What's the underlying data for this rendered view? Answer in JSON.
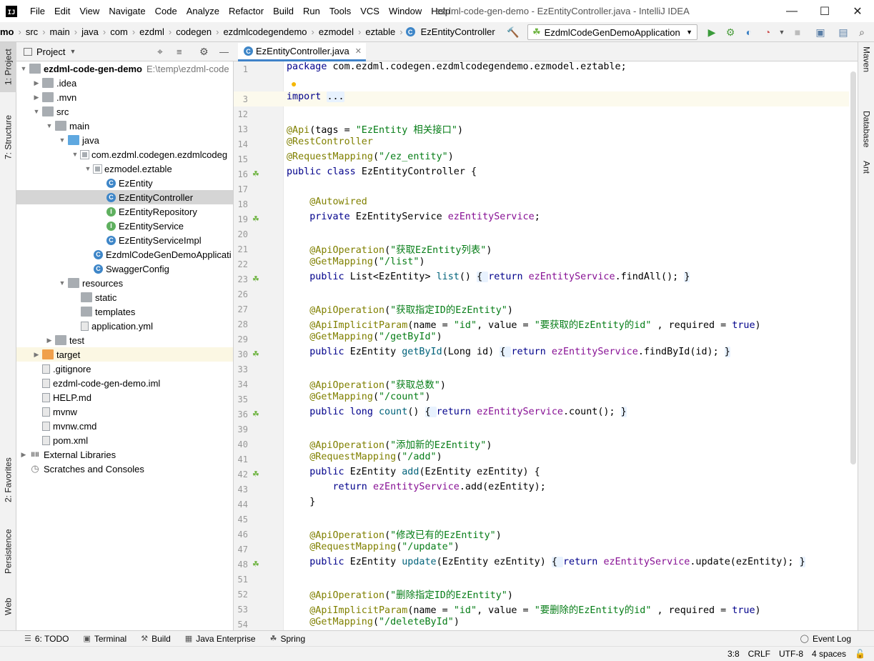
{
  "window": {
    "title": "ezdml-code-gen-demo - EzEntityController.java - IntelliJ IDEA",
    "app_icon": "IJ",
    "controls": [
      "—",
      "☐",
      "✕"
    ]
  },
  "menu": [
    "File",
    "Edit",
    "View",
    "Navigate",
    "Code",
    "Analyze",
    "Refactor",
    "Build",
    "Run",
    "Tools",
    "VCS",
    "Window",
    "Help"
  ],
  "breadcrumbs": [
    "mo",
    "src",
    "main",
    "java",
    "com",
    "ezdml",
    "codegen",
    "ezdmlcodegendemo",
    "ezmodel",
    "eztable",
    "EzEntityController"
  ],
  "run_config": "EzdmlCodeGenDemoApplication",
  "left_tools": [
    "1: Project",
    "7: Structure",
    "2: Favorites",
    "Persistence",
    "Web"
  ],
  "right_tools": [
    "Maven",
    "Database",
    "Ant"
  ],
  "project_panel": {
    "title": "Project",
    "tree": [
      {
        "label": "ezdml-code-gen-demo",
        "extra": "E:\\temp\\ezdml-code",
        "depth": 0,
        "arrow": "down",
        "icon": "folder",
        "bold": true
      },
      {
        "label": ".idea",
        "depth": 1,
        "arrow": "right",
        "icon": "folder"
      },
      {
        "label": ".mvn",
        "depth": 1,
        "arrow": "right",
        "icon": "folder"
      },
      {
        "label": "src",
        "depth": 1,
        "arrow": "down",
        "icon": "folder"
      },
      {
        "label": "main",
        "depth": 2,
        "arrow": "down",
        "icon": "folder"
      },
      {
        "label": "java",
        "depth": 3,
        "arrow": "down",
        "icon": "folder-blue"
      },
      {
        "label": "com.ezdml.codegen.ezdmlcodeg",
        "depth": 4,
        "arrow": "down",
        "icon": "package"
      },
      {
        "label": "ezmodel.eztable",
        "depth": 5,
        "arrow": "down",
        "icon": "package"
      },
      {
        "label": "EzEntity",
        "depth": 6,
        "arrow": "",
        "icon": "class"
      },
      {
        "label": "EzEntityController",
        "depth": 6,
        "arrow": "",
        "icon": "class",
        "selected": true
      },
      {
        "label": "EzEntityRepository",
        "depth": 6,
        "arrow": "",
        "icon": "interface"
      },
      {
        "label": "EzEntityService",
        "depth": 6,
        "arrow": "",
        "icon": "interface"
      },
      {
        "label": "EzEntityServiceImpl",
        "depth": 6,
        "arrow": "",
        "icon": "class"
      },
      {
        "label": "EzdmlCodeGenDemoApplicati",
        "depth": 5,
        "arrow": "",
        "icon": "class"
      },
      {
        "label": "SwaggerConfig",
        "depth": 5,
        "arrow": "",
        "icon": "class"
      },
      {
        "label": "resources",
        "depth": 3,
        "arrow": "down",
        "icon": "folder"
      },
      {
        "label": "static",
        "depth": 4,
        "arrow": "",
        "icon": "folder"
      },
      {
        "label": "templates",
        "depth": 4,
        "arrow": "",
        "icon": "folder"
      },
      {
        "label": "application.yml",
        "depth": 4,
        "arrow": "",
        "icon": "file"
      },
      {
        "label": "test",
        "depth": 2,
        "arrow": "right",
        "icon": "folder"
      },
      {
        "label": "target",
        "depth": 1,
        "arrow": "right",
        "icon": "folder-orange",
        "target": true
      },
      {
        "label": ".gitignore",
        "depth": 1,
        "arrow": "",
        "icon": "file"
      },
      {
        "label": "ezdml-code-gen-demo.iml",
        "depth": 1,
        "arrow": "",
        "icon": "file"
      },
      {
        "label": "HELP.md",
        "depth": 1,
        "arrow": "",
        "icon": "file"
      },
      {
        "label": "mvnw",
        "depth": 1,
        "arrow": "",
        "icon": "file"
      },
      {
        "label": "mvnw.cmd",
        "depth": 1,
        "arrow": "",
        "icon": "file"
      },
      {
        "label": "pom.xml",
        "depth": 1,
        "arrow": "",
        "icon": "file"
      },
      {
        "label": "External Libraries",
        "depth": 0,
        "arrow": "right",
        "icon": "library"
      },
      {
        "label": "Scratches and Consoles",
        "depth": 0,
        "arrow": "",
        "icon": "scratch"
      }
    ]
  },
  "editor": {
    "tab": "EzEntityController.java",
    "lines": [
      {
        "n": "1",
        "code": [
          [
            "kw",
            "package "
          ],
          [
            "",
            "com.ezdml.codegen.ezdmlcodegendemo.ezmodel.eztable;"
          ]
        ]
      },
      {
        "n": "",
        "code": [],
        "bulb": true
      },
      {
        "n": "3",
        "code": [
          [
            "kw",
            "import "
          ],
          [
            "fold",
            "..."
          ]
        ],
        "current": true
      },
      {
        "n": "12",
        "code": []
      },
      {
        "n": "13",
        "code": [
          [
            "an",
            "@Api"
          ],
          [
            "",
            "(tags = "
          ],
          [
            "st",
            "\"EzEntity 相关接口\""
          ],
          [
            "",
            ")"
          ]
        ]
      },
      {
        "n": "14",
        "code": [
          [
            "an",
            "@RestController"
          ]
        ]
      },
      {
        "n": "15",
        "code": [
          [
            "an",
            "@RequestMapping"
          ],
          [
            "",
            "("
          ],
          [
            "st",
            "\"/ez_entity\""
          ],
          [
            "",
            ")"
          ]
        ]
      },
      {
        "n": "16",
        "code": [
          [
            "kw",
            "public class "
          ],
          [
            "",
            "EzEntityController {"
          ]
        ],
        "gi": true
      },
      {
        "n": "17",
        "code": []
      },
      {
        "n": "18",
        "code": [
          [
            "",
            "    "
          ],
          [
            "an",
            "@Autowired"
          ]
        ]
      },
      {
        "n": "19",
        "code": [
          [
            "",
            "    "
          ],
          [
            "kw",
            "private "
          ],
          [
            "",
            "EzEntityService "
          ],
          [
            "fd",
            "ezEntityService"
          ],
          [
            "",
            ";"
          ]
        ],
        "gi": true
      },
      {
        "n": "20",
        "code": []
      },
      {
        "n": "21",
        "code": [
          [
            "",
            "    "
          ],
          [
            "an",
            "@ApiOperation"
          ],
          [
            "",
            "("
          ],
          [
            "st",
            "\"获取EzEntity列表\""
          ],
          [
            "",
            ")"
          ]
        ]
      },
      {
        "n": "22",
        "code": [
          [
            "",
            "    "
          ],
          [
            "an",
            "@GetMapping"
          ],
          [
            "",
            "("
          ],
          [
            "st",
            "\"/list\""
          ],
          [
            "",
            ")"
          ]
        ]
      },
      {
        "n": "23",
        "code": [
          [
            "",
            "    "
          ],
          [
            "kw",
            "public "
          ],
          [
            "",
            "List<EzEntity> "
          ],
          [
            "mt",
            "list"
          ],
          [
            "",
            "() "
          ],
          [
            "fold",
            "{ "
          ],
          [
            "kw",
            "return "
          ],
          [
            "fd",
            "ezEntityService"
          ],
          [
            "",
            ".findAll(); "
          ],
          [
            "fold",
            "}"
          ]
        ],
        "gi": true
      },
      {
        "n": "26",
        "code": []
      },
      {
        "n": "27",
        "code": [
          [
            "",
            "    "
          ],
          [
            "an",
            "@ApiOperation"
          ],
          [
            "",
            "("
          ],
          [
            "st",
            "\"获取指定ID的EzEntity\""
          ],
          [
            "",
            ")"
          ]
        ]
      },
      {
        "n": "28",
        "code": [
          [
            "",
            "    "
          ],
          [
            "an",
            "@ApiImplicitParam"
          ],
          [
            "",
            "(name = "
          ],
          [
            "st",
            "\"id\""
          ],
          [
            "",
            ", value = "
          ],
          [
            "st",
            "\"要获取的EzEntity的id\""
          ],
          [
            "",
            " , required = "
          ],
          [
            "kw",
            "true"
          ],
          [
            "",
            ")"
          ]
        ]
      },
      {
        "n": "29",
        "code": [
          [
            "",
            "    "
          ],
          [
            "an",
            "@GetMapping"
          ],
          [
            "",
            "("
          ],
          [
            "st",
            "\"/getById\""
          ],
          [
            "",
            ")"
          ]
        ]
      },
      {
        "n": "30",
        "code": [
          [
            "",
            "    "
          ],
          [
            "kw",
            "public "
          ],
          [
            "",
            "EzEntity "
          ],
          [
            "mt",
            "getById"
          ],
          [
            "",
            "(Long id) "
          ],
          [
            "fold",
            "{ "
          ],
          [
            "kw",
            "return "
          ],
          [
            "fd",
            "ezEntityService"
          ],
          [
            "",
            ".findById(id); "
          ],
          [
            "fold",
            "}"
          ]
        ],
        "gi": true
      },
      {
        "n": "33",
        "code": []
      },
      {
        "n": "34",
        "code": [
          [
            "",
            "    "
          ],
          [
            "an",
            "@ApiOperation"
          ],
          [
            "",
            "("
          ],
          [
            "st",
            "\"获取总数\""
          ],
          [
            "",
            ")"
          ]
        ]
      },
      {
        "n": "35",
        "code": [
          [
            "",
            "    "
          ],
          [
            "an",
            "@GetMapping"
          ],
          [
            "",
            "("
          ],
          [
            "st",
            "\"/count\""
          ],
          [
            "",
            ")"
          ]
        ]
      },
      {
        "n": "36",
        "code": [
          [
            "",
            "    "
          ],
          [
            "kw",
            "public long "
          ],
          [
            "mt",
            "count"
          ],
          [
            "",
            "() "
          ],
          [
            "fold",
            "{ "
          ],
          [
            "kw",
            "return "
          ],
          [
            "fd",
            "ezEntityService"
          ],
          [
            "",
            ".count(); "
          ],
          [
            "fold",
            "}"
          ]
        ],
        "gi": true
      },
      {
        "n": "39",
        "code": []
      },
      {
        "n": "40",
        "code": [
          [
            "",
            "    "
          ],
          [
            "an",
            "@ApiOperation"
          ],
          [
            "",
            "("
          ],
          [
            "st",
            "\"添加新的EzEntity\""
          ],
          [
            "",
            ")"
          ]
        ]
      },
      {
        "n": "41",
        "code": [
          [
            "",
            "    "
          ],
          [
            "an",
            "@RequestMapping"
          ],
          [
            "",
            "("
          ],
          [
            "st",
            "\"/add\""
          ],
          [
            "",
            ")"
          ]
        ]
      },
      {
        "n": "42",
        "code": [
          [
            "",
            "    "
          ],
          [
            "kw",
            "public "
          ],
          [
            "",
            "EzEntity "
          ],
          [
            "mt",
            "add"
          ],
          [
            "",
            "(EzEntity ezEntity) {"
          ]
        ],
        "gi": true
      },
      {
        "n": "43",
        "code": [
          [
            "",
            "        "
          ],
          [
            "kw",
            "return "
          ],
          [
            "fd",
            "ezEntityService"
          ],
          [
            "",
            ".add(ezEntity);"
          ]
        ]
      },
      {
        "n": "44",
        "code": [
          [
            "",
            "    }"
          ]
        ]
      },
      {
        "n": "45",
        "code": []
      },
      {
        "n": "46",
        "code": [
          [
            "",
            "    "
          ],
          [
            "an",
            "@ApiOperation"
          ],
          [
            "",
            "("
          ],
          [
            "st",
            "\"修改已有的EzEntity\""
          ],
          [
            "",
            ")"
          ]
        ]
      },
      {
        "n": "47",
        "code": [
          [
            "",
            "    "
          ],
          [
            "an",
            "@RequestMapping"
          ],
          [
            "",
            "("
          ],
          [
            "st",
            "\"/update\""
          ],
          [
            "",
            ")"
          ]
        ]
      },
      {
        "n": "48",
        "code": [
          [
            "",
            "    "
          ],
          [
            "kw",
            "public "
          ],
          [
            "",
            "EzEntity "
          ],
          [
            "mt",
            "update"
          ],
          [
            "",
            "(EzEntity ezEntity) "
          ],
          [
            "fold",
            "{ "
          ],
          [
            "kw",
            "return "
          ],
          [
            "fd",
            "ezEntityService"
          ],
          [
            "",
            ".update(ezEntity); "
          ],
          [
            "fold",
            "}"
          ]
        ],
        "gi": true
      },
      {
        "n": "51",
        "code": []
      },
      {
        "n": "52",
        "code": [
          [
            "",
            "    "
          ],
          [
            "an",
            "@ApiOperation"
          ],
          [
            "",
            "("
          ],
          [
            "st",
            "\"删除指定ID的EzEntity\""
          ],
          [
            "",
            ")"
          ]
        ]
      },
      {
        "n": "53",
        "code": [
          [
            "",
            "    "
          ],
          [
            "an",
            "@ApiImplicitParam"
          ],
          [
            "",
            "(name = "
          ],
          [
            "st",
            "\"id\""
          ],
          [
            "",
            ", value = "
          ],
          [
            "st",
            "\"要删除的EzEntity的id\""
          ],
          [
            "",
            " , required = "
          ],
          [
            "kw",
            "true"
          ],
          [
            "",
            ")"
          ]
        ]
      },
      {
        "n": "54",
        "code": [
          [
            "",
            "    "
          ],
          [
            "an",
            "@GetMapping"
          ],
          [
            "",
            "("
          ],
          [
            "st",
            "\"/deleteById\""
          ],
          [
            "",
            ")"
          ]
        ]
      }
    ]
  },
  "bottom_tabs": [
    {
      "label": "6: TODO",
      "icon": "list-icon"
    },
    {
      "label": "Terminal",
      "icon": "terminal-icon"
    },
    {
      "label": "Build",
      "icon": "hammer-icon"
    },
    {
      "label": "Java Enterprise",
      "icon": "java-ee-icon"
    },
    {
      "label": "Spring",
      "icon": "spring-icon"
    }
  ],
  "event_log": "Event Log",
  "status": {
    "position": "3:8",
    "line_sep": "CRLF",
    "encoding": "UTF-8",
    "indent": "4 spaces"
  },
  "colors": {
    "keyword": "#00008b",
    "annotation": "#808000",
    "string": "#067d17",
    "field": "#871094",
    "method": "#00627a",
    "selection": "#d5d5d5",
    "accent": "#4083c9"
  }
}
